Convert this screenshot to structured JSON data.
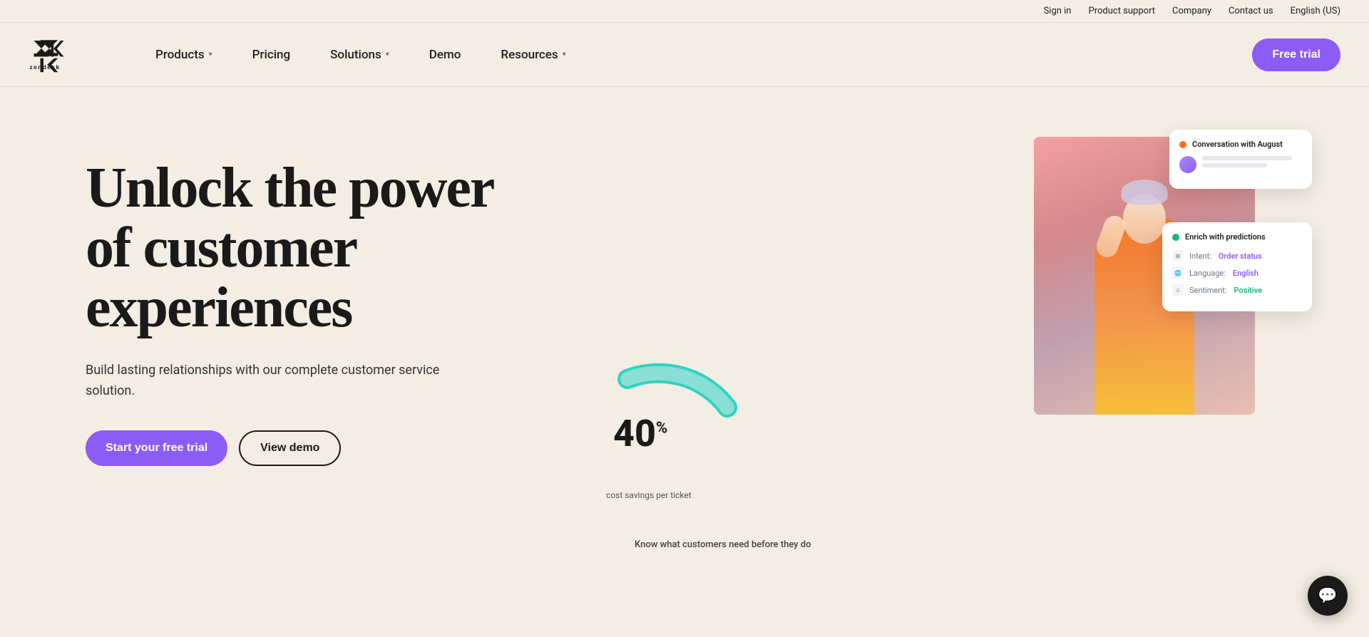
{
  "topbar": {
    "sign_in": "Sign in",
    "product_support": "Product support",
    "company": "Company",
    "contact_us": "Contact us",
    "language": "English (US)"
  },
  "nav": {
    "logo_alt": "Zendesk",
    "items": [
      {
        "label": "Products",
        "has_dropdown": true
      },
      {
        "label": "Pricing",
        "has_dropdown": false
      },
      {
        "label": "Solutions",
        "has_dropdown": true
      },
      {
        "label": "Demo",
        "has_dropdown": false
      },
      {
        "label": "Resources",
        "has_dropdown": true
      }
    ],
    "free_trial": "Free trial"
  },
  "hero": {
    "title_line1": "Unlock the power",
    "title_line2": "of customer",
    "title_line3": "experiences",
    "subtitle": "Build lasting relationships with our complete customer service solution.",
    "cta_primary": "Start your free trial",
    "cta_secondary": "View demo",
    "image_caption": "Know what customers need before they do"
  },
  "conversation_card": {
    "title": "Conversation with August",
    "dot_color": "#f97316"
  },
  "predictions_card": {
    "title": "Enrich with predictions",
    "dot_color": "#10b981",
    "rows": [
      {
        "label": "Intent:",
        "value": "Order status",
        "value_color": "#8b5cf6"
      },
      {
        "label": "Language:",
        "value": "English",
        "value_color": "#8b5cf6"
      },
      {
        "label": "Sentiment:",
        "value": "Positive",
        "value_color": "#10b981"
      }
    ]
  },
  "gauge": {
    "number": "40",
    "percent_symbol": "%",
    "label": "cost savings per ticket",
    "arc_color": "#2dd4bf"
  },
  "chat_bubble": {
    "icon": "💬"
  }
}
